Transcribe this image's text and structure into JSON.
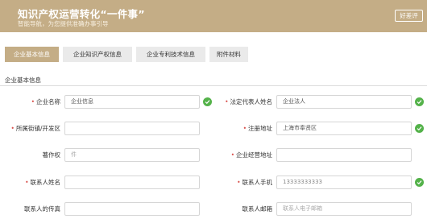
{
  "banner": {
    "title": "知识产权运营转化“一件事”",
    "subtitle": "智能导航，为您提供准确办事引导",
    "praise_button": "好差评"
  },
  "tabs": [
    {
      "label": "企业基本信息",
      "active": true
    },
    {
      "label": "企业知识产权信息",
      "active": false
    },
    {
      "label": "企业专利技术信息",
      "active": false
    },
    {
      "label": "附件材料",
      "active": false
    }
  ],
  "section": {
    "title": "企业基本信息"
  },
  "fields": {
    "company_name": {
      "label": "企业名称",
      "required": true,
      "value": "企业信息",
      "valid": true
    },
    "legal_rep": {
      "label": "法定代表人姓名",
      "required": true,
      "value": "企业法人",
      "valid": true
    },
    "district": {
      "label": "所属街镇/开发区",
      "required": true,
      "value": "",
      "valid": false
    },
    "reg_address": {
      "label": "注册地址",
      "required": true,
      "value": "上海市奉贤区",
      "valid": true
    },
    "copyright": {
      "label": "著作权",
      "required": false,
      "placeholder": "件",
      "valid": false
    },
    "business_address": {
      "label": "企业经营地址",
      "required": true,
      "value": "",
      "valid": false
    },
    "contact_name": {
      "label": "联系人姓名",
      "required": true,
      "value": "",
      "valid": false
    },
    "contact_phone": {
      "label": "联系人手机",
      "required": true,
      "value": "13333333333",
      "valid": true
    },
    "contact_fax": {
      "label": "联系人的传真",
      "required": false,
      "value": "",
      "valid": false
    },
    "contact_email": {
      "label": "联系人邮箱",
      "required": false,
      "placeholder": "联系人电子邮箱",
      "valid": false
    }
  },
  "colors": {
    "accent": "#c4ad86",
    "valid": "#54b24a",
    "required": "#d9534f"
  }
}
